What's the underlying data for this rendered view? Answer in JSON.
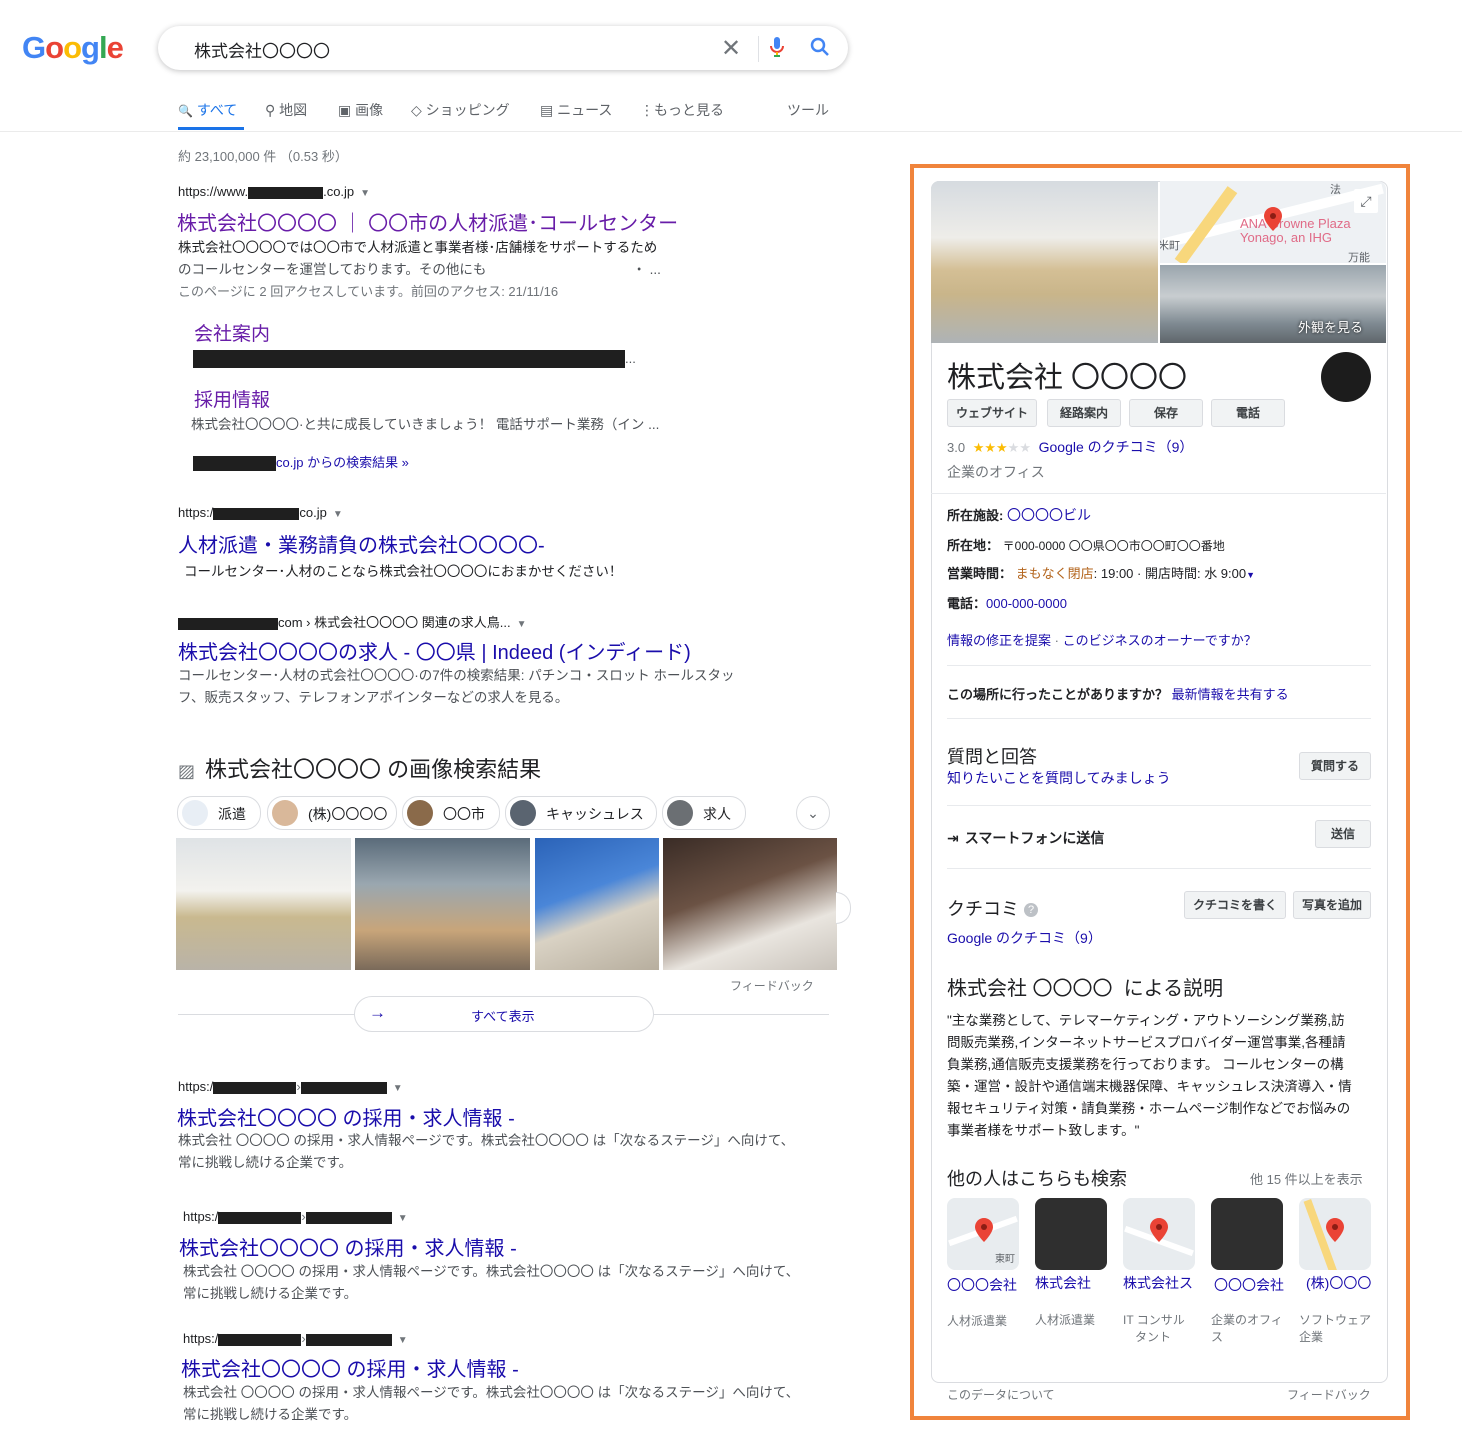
{
  "header": {
    "logo": "Google",
    "query": "株式会社〇〇〇〇"
  },
  "tabs": [
    {
      "label": "すべて",
      "icon": "search-icon"
    },
    {
      "label": "地図",
      "icon": "map-pin-icon"
    },
    {
      "label": "画像",
      "icon": "image-icon"
    },
    {
      "label": "ショッピング",
      "icon": "tag-icon"
    },
    {
      "label": "ニュース",
      "icon": "news-icon"
    },
    {
      "label": "もっと見る",
      "icon": "more-vert-icon"
    }
  ],
  "tools": "ツール",
  "stats": "約 23,100,000 件 （0.53 秒）",
  "results": {
    "r1": {
      "url_pre": "https://www.",
      "url_post": ".co.jp",
      "title": "株式会社〇〇〇〇 ｜ 〇〇市の人材派遣･コールセンター",
      "snip1": "株式会社〇〇〇〇では〇〇市で人材派遣と事業者様･店舗様をサポートするため",
      "snip2": "のコールセンターを運営しております。その他にも",
      "snip2_tail": "・ ...",
      "visit": "このページに 2 回アクセスしています。前回のアクセス: 21/11/16",
      "sitelink1": "会社案内",
      "sitelink1_tail": "...",
      "sitelink2": "採用情報",
      "sitelink2_snip": "株式会社〇〇〇〇·と共に成長していきましょう！ 電話サポート業務（イン ...",
      "more": "co.jp からの検索結果 »"
    },
    "r2": {
      "url_pre": "https:/",
      "url_post": "co.jp",
      "title": "人材派遣・業務請負の株式会社〇〇〇〇-",
      "snip": "コールセンター･人材のことなら株式会社〇〇〇〇におまかせください！"
    },
    "r3": {
      "url_post": "com › 株式会社〇〇〇〇 関連の求人鳥...",
      "title": "株式会社〇〇〇〇の求人 - 〇〇県 | Indeed (インディード)",
      "snip1": "コールセンター･人材の式会社〇〇〇〇·の7件の検索結果: パチンコ・スロット ホールスタッ",
      "snip2": "フ、販売スタッフ、テレフォンアポインターなどの求人を見る。"
    },
    "r4": {
      "url_pre": "https:/",
      "title": "株式会社〇〇〇〇 の採用・求人情報 -",
      "snip1": "株式会社 〇〇〇〇 の採用・求人情報ページです。株式会社〇〇〇〇 は「次なるステージ」へ向けて、",
      "snip2": "常に挑戦し続ける企業です。"
    },
    "r5": {
      "url_pre": "https:/",
      "title": "株式会社〇〇〇〇 の採用・求人情報 -",
      "snip1": "株式会社 〇〇〇〇 の採用・求人情報ページです。株式会社〇〇〇〇 は「次なるステージ」へ向けて、",
      "snip2": "常に挑戦し続ける企業です。"
    },
    "r6": {
      "url_pre": "https:/",
      "title": "株式会社〇〇〇〇 の採用・求人情報 -",
      "snip1": "株式会社 〇〇〇〇 の採用・求人情報ページです。株式会社〇〇〇〇 は「次なるステージ」へ向けて、",
      "snip2": "常に挑戦し続ける企業です。"
    }
  },
  "images": {
    "heading": "株式会社〇〇〇〇 の画像検索結果",
    "chips": [
      "派遣",
      "(株)〇〇〇〇",
      "〇〇市",
      "キャッシュレス",
      "求人"
    ],
    "feedback": "フィードバック",
    "show_all": "すべて表示"
  },
  "kp": {
    "map_label": "ANA Crowne Plaza Yonago, an IHG",
    "map_street1": "米町",
    "map_street2": "万能",
    "map_street3": "法",
    "exterior": "外観を見る",
    "name": "株式会社 〇〇〇〇",
    "buttons": [
      "ウェブサイト",
      "経路案内",
      "保存",
      "電話"
    ],
    "rating": "3.0",
    "rating_value": 3,
    "reviews_link": "Google のクチコミ（9）",
    "category": "企業のオフィス",
    "facility_label": "所在施設:",
    "facility": "〇〇〇〇ビル",
    "address_label": "所在地：",
    "address": "〒000-0000 〇〇県〇〇市〇〇町〇〇番地",
    "hours_label": "営業時間：",
    "hours_status": "まもなく閉店",
    "hours_detail": ": 19:00 · 開店時間: 水 9:00",
    "phone_label": "電話：",
    "phone": "000-000-0000",
    "suggest": "情報の修正を提案",
    "owner": "このビジネスのオーナーですか？",
    "visited_q": "この場所に行ったことがありますか？",
    "share": "最新情報を共有する",
    "qa_title": "質問と回答",
    "qa_sub": "知りたいことを質問してみましょう",
    "qa_btn": "質問する",
    "send_label": "スマートフォンに送信",
    "send_btn": "送信",
    "reviews_title": "クチコミ",
    "write_review": "クチコミを書く",
    "add_photo": "写真を追加",
    "reviews_link2": "Google のクチコミ（9）",
    "desc_title": "株式会社 〇〇〇〇  による説明",
    "desc_lines": [
      "\"主な業務として、テレマーケティング・アウトソーシング業務,訪",
      "問販売業務,インターネットサービスプロバイダー運営事業,各種請",
      "負業務,通信販売支援業務を行っております。 コールセンターの構",
      "築・運営・設計や通信端末機器保障、キャッシュレス決済導入・情",
      "報セキュリティ対策・請負業務・ホームページ制作などでお悩みの",
      "事業者様をサポート致します。\""
    ],
    "pa_title": "他の人はこちらも検索",
    "pa_more": "他 15 件以上を表示",
    "pa_map_street": "東町",
    "pa": [
      {
        "name": "〇〇〇会社",
        "cat": [
          "人材派遣業"
        ]
      },
      {
        "name": "株式会社",
        "cat": [
          "人材派遣業"
        ]
      },
      {
        "name": "株式会社ス",
        "cat": [
          "IT コンサル",
          "タント"
        ]
      },
      {
        "name": "〇〇〇会社",
        "cat": [
          "企業のオフィ",
          "ス"
        ]
      },
      {
        "name": "(株)〇〇〇",
        "cat": [
          "ソフトウェア",
          "企業"
        ]
      }
    ],
    "about": "このデータについて",
    "feedback": "フィードバック"
  },
  "colors": {
    "link": "#1a0dab",
    "visited": "#681da8",
    "accent": "#1a73e8",
    "frame": "#f0843c",
    "closing": "#b3641c"
  }
}
